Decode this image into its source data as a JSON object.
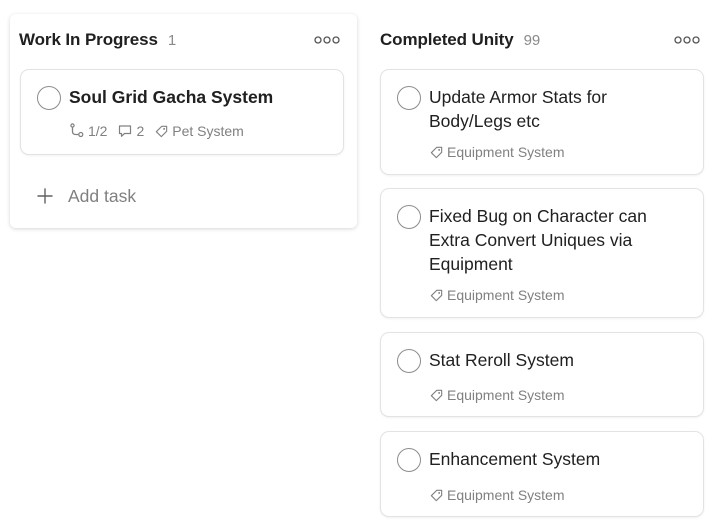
{
  "columns": [
    {
      "title": "Work In Progress",
      "count": "1",
      "more_icon": "ellipsis-icon",
      "tasks": [
        {
          "title": "Soul Grid Gacha System",
          "subtasks": "1/2",
          "comments": "2",
          "label": "Pet System"
        }
      ],
      "add_task_label": "Add task"
    },
    {
      "title": "Completed Unity",
      "count": "99",
      "more_icon": "ellipsis-icon",
      "tasks": [
        {
          "title": "Update Armor Stats for Body/Legs etc",
          "label": "Equipment System"
        },
        {
          "title": "Fixed Bug on Character can Extra Convert Uniques via Equipment",
          "label": "Equipment System"
        },
        {
          "title": "Stat Reroll System",
          "label": "Equipment System"
        },
        {
          "title": "Enhancement System",
          "label": "Equipment System"
        }
      ]
    }
  ],
  "colors": {
    "text": "#202020",
    "muted": "#808080",
    "border": "#e3e3e3",
    "checkbox": "#8c8c8c"
  }
}
